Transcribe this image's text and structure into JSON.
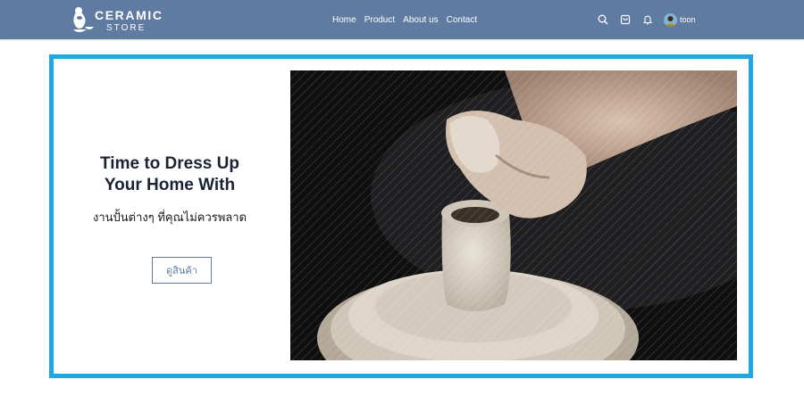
{
  "brand": {
    "name_line1": "CERAMIC",
    "name_line2": "STORE"
  },
  "nav": {
    "links": [
      "Home",
      "Product",
      "About us",
      "Contact"
    ]
  },
  "icons": [
    "search-icon",
    "cart-icon",
    "bell-icon"
  ],
  "user": {
    "name": "toon"
  },
  "hero": {
    "title_line1": "Time to Dress Up",
    "title_line2": "Your Home With",
    "subtitle": "งานปั้นต่างๆ ที่คุณไม่ควรพลาด",
    "button_label": "ดูสินค้า",
    "image_alt": "pottery-wheel-photo"
  },
  "colors": {
    "navbar": "#5f7ba2",
    "hero_border": "#1ea8e4",
    "button": "#5f7ba2",
    "title": "#1a2233"
  }
}
